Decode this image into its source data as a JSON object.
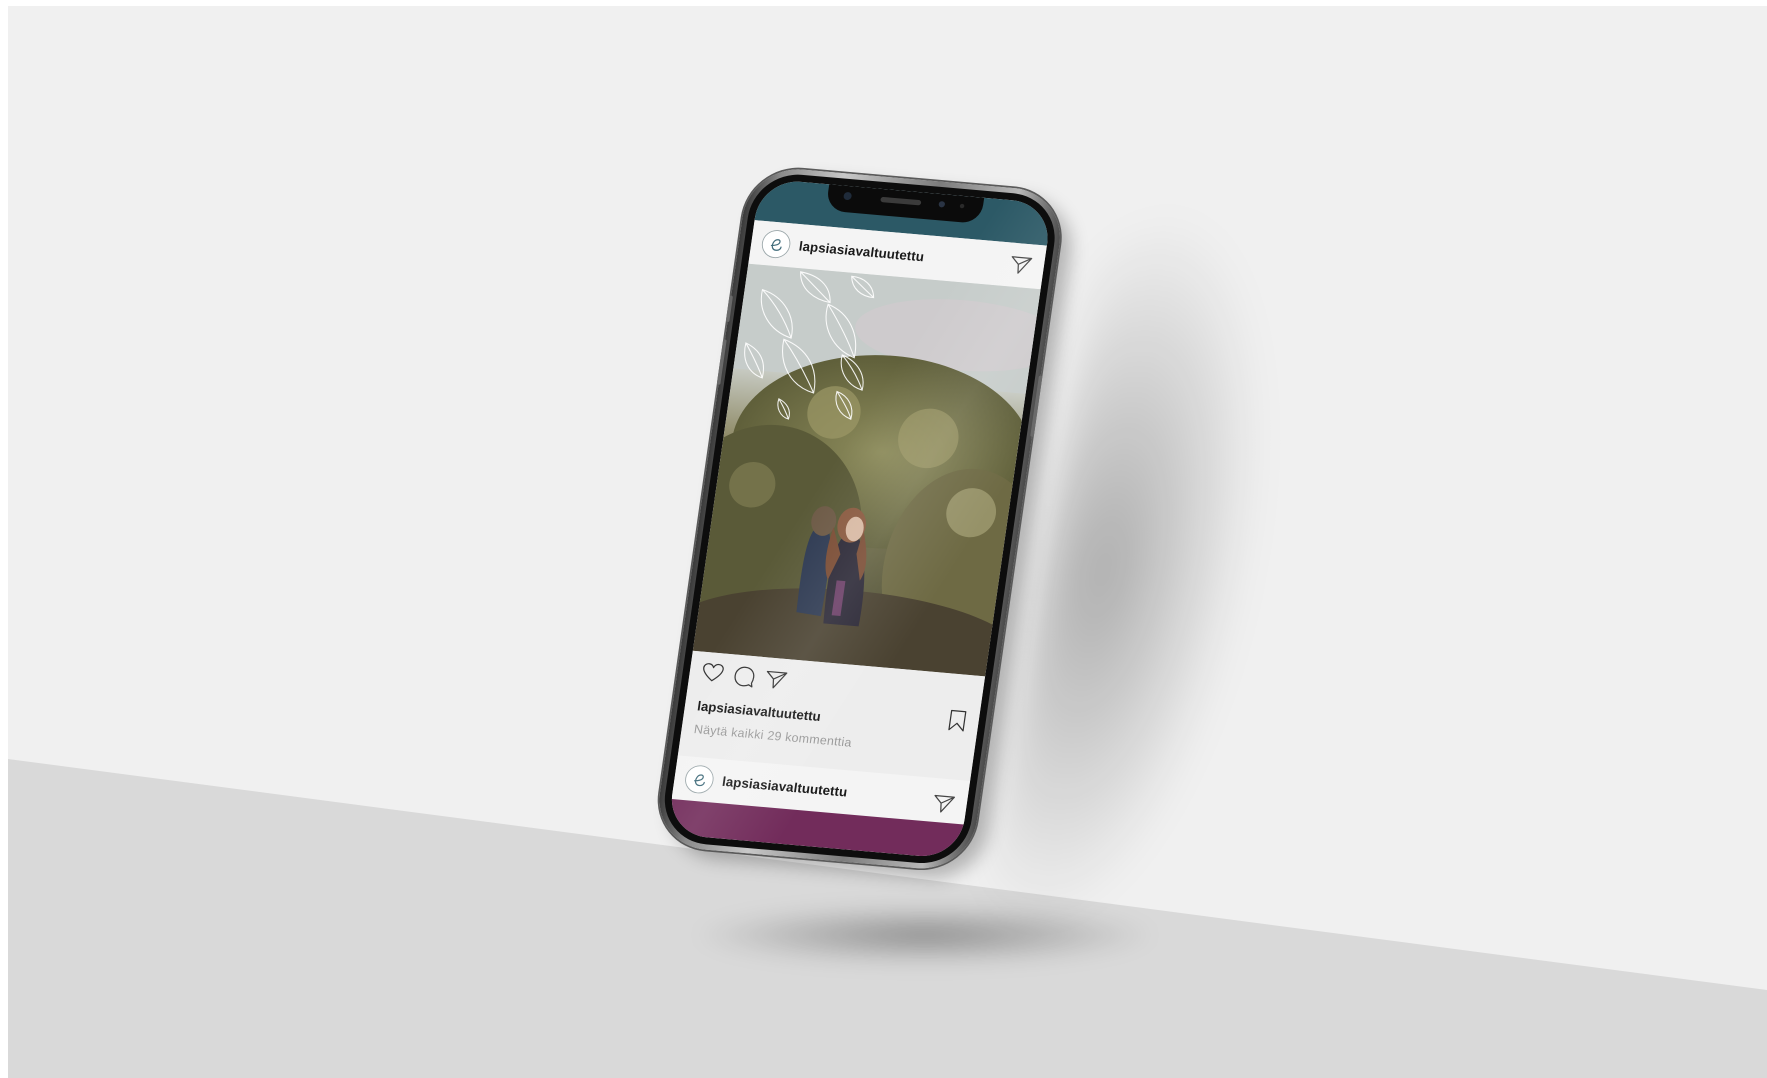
{
  "feed": {
    "header_top": {
      "avatar_icon": "swirl-logo-icon",
      "username": "lapsiasiavaltuutettu",
      "send_icon": "paper-plane-icon"
    },
    "post": {
      "image_description_icon": "leaf-pattern-icon",
      "actions": {
        "like_icon": "heart-icon",
        "comment_icon": "speech-bubble-icon",
        "share_icon": "paper-plane-icon",
        "save_icon": "bookmark-icon"
      },
      "username": "lapsiasiavaltuutettu",
      "comments_link": "Näytä kaikki 29 kommenttia"
    },
    "header_bottom": {
      "avatar_icon": "swirl-logo-icon",
      "username": "lapsiasiavaltuutettu",
      "send_icon": "paper-plane-icon"
    }
  },
  "colors": {
    "wall": "#f0f0f0",
    "floor": "#d9d9d9",
    "top_band": "#2c5966",
    "bottom_band": "#722c5b",
    "post_background": "#f4f4f4",
    "username_text": "#1a1a1a",
    "comments_text": "#9a9a9a"
  }
}
